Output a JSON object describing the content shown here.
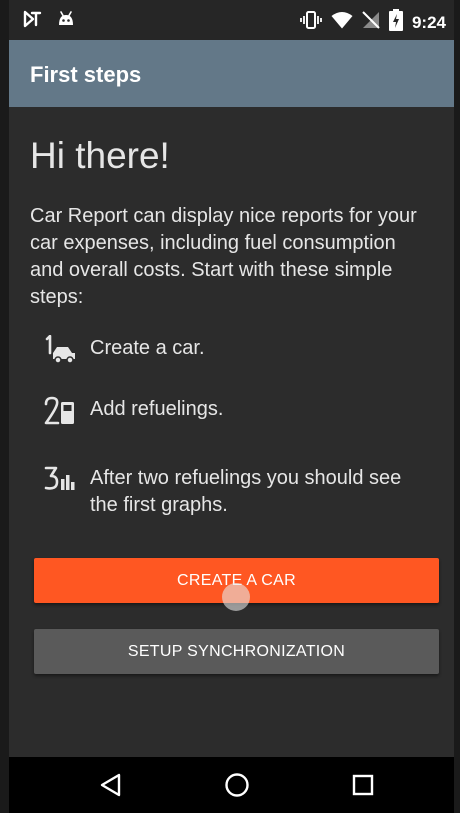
{
  "status_bar": {
    "time": "9:24",
    "left_icons": [
      "notification-icon",
      "android-icon"
    ],
    "right_icons": [
      "vibrate-icon",
      "wifi-icon",
      "no-sim-icon",
      "battery-charging-icon"
    ]
  },
  "app_bar": {
    "title": "First steps",
    "color": "#637888"
  },
  "main": {
    "greeting": "Hi there!",
    "intro": "Car Report can display nice reports for your car expenses, including fuel consumption and overall costs. Start with these simple steps:",
    "steps": [
      {
        "icon": "step-one-car-icon",
        "text": "Create a car."
      },
      {
        "icon": "step-two-fuel-icon",
        "text": "Add refuelings."
      },
      {
        "icon": "step-three-graph-icon",
        "text": "After two refuelings you should see the first graphs."
      }
    ],
    "primary_button": {
      "label": "CREATE A CAR",
      "color": "#ff5722"
    },
    "secondary_button": {
      "label": "SETUP SYNCHRONIZATION",
      "color": "#5a5a5a"
    }
  },
  "nav_bar": {
    "buttons": [
      "back-icon",
      "home-icon",
      "recents-icon"
    ]
  }
}
